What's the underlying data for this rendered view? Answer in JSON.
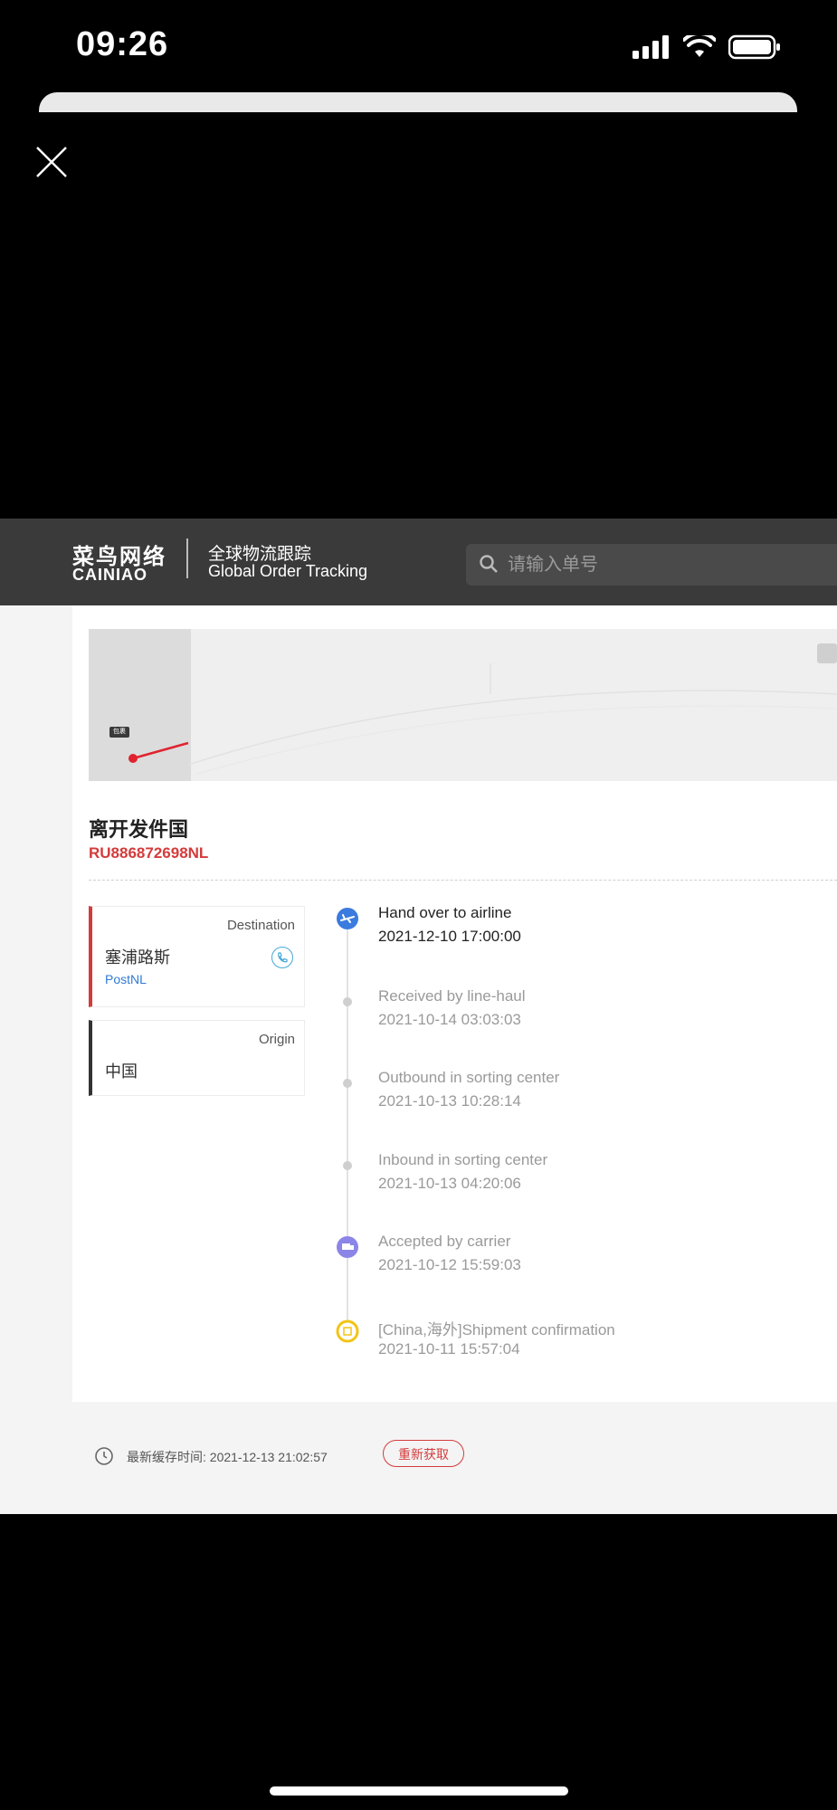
{
  "status_bar": {
    "time": "09:26",
    "icons": [
      "signal-icon",
      "wifi-icon",
      "battery-icon"
    ]
  },
  "site": {
    "header": {
      "logo_cn": "菜鸟网络",
      "logo_en": "CAINIAO",
      "subtitle_cn": "全球物流跟踪",
      "subtitle_en": "Global Order Tracking",
      "search_placeholder": "请输入单号"
    },
    "map": {
      "marker_label": "包裹"
    },
    "shipment": {
      "status_title": "离开发件国",
      "tracking_number": "RU886872698NL"
    },
    "destination": {
      "role": "Destination",
      "name": "塞浦路斯",
      "carrier": "PostNL"
    },
    "origin": {
      "role": "Origin",
      "name": "中国"
    },
    "timeline": [
      {
        "title": "Hand over to airline",
        "time": "2021-12-10 17:00:00",
        "icon": "airplane-icon",
        "active": true
      },
      {
        "title": "Received by line-haul",
        "time": "2021-10-14 03:03:03",
        "icon": "dot-icon",
        "active": false
      },
      {
        "title": "Outbound in sorting center",
        "time": "2021-10-13 10:28:14",
        "icon": "dot-icon",
        "active": false
      },
      {
        "title": "Inbound in sorting center",
        "time": "2021-10-13 04:20:06",
        "icon": "dot-icon",
        "active": false
      },
      {
        "title": "Accepted by carrier",
        "time": "2021-10-12 15:59:03",
        "icon": "truck-icon",
        "active": false
      },
      {
        "title": "[China,海外]Shipment confirmation",
        "time": "2021-10-11 15:57:04",
        "icon": "box-icon",
        "active": false
      }
    ],
    "footer": {
      "cache_label": "最新缓存时间: 2021-12-13 21:02:57",
      "refresh_label": "重新获取"
    },
    "colors": {
      "accent_red": "#d43b3b",
      "header_bg": "#3a3a3a",
      "link_blue": "#2f7bd6"
    }
  }
}
